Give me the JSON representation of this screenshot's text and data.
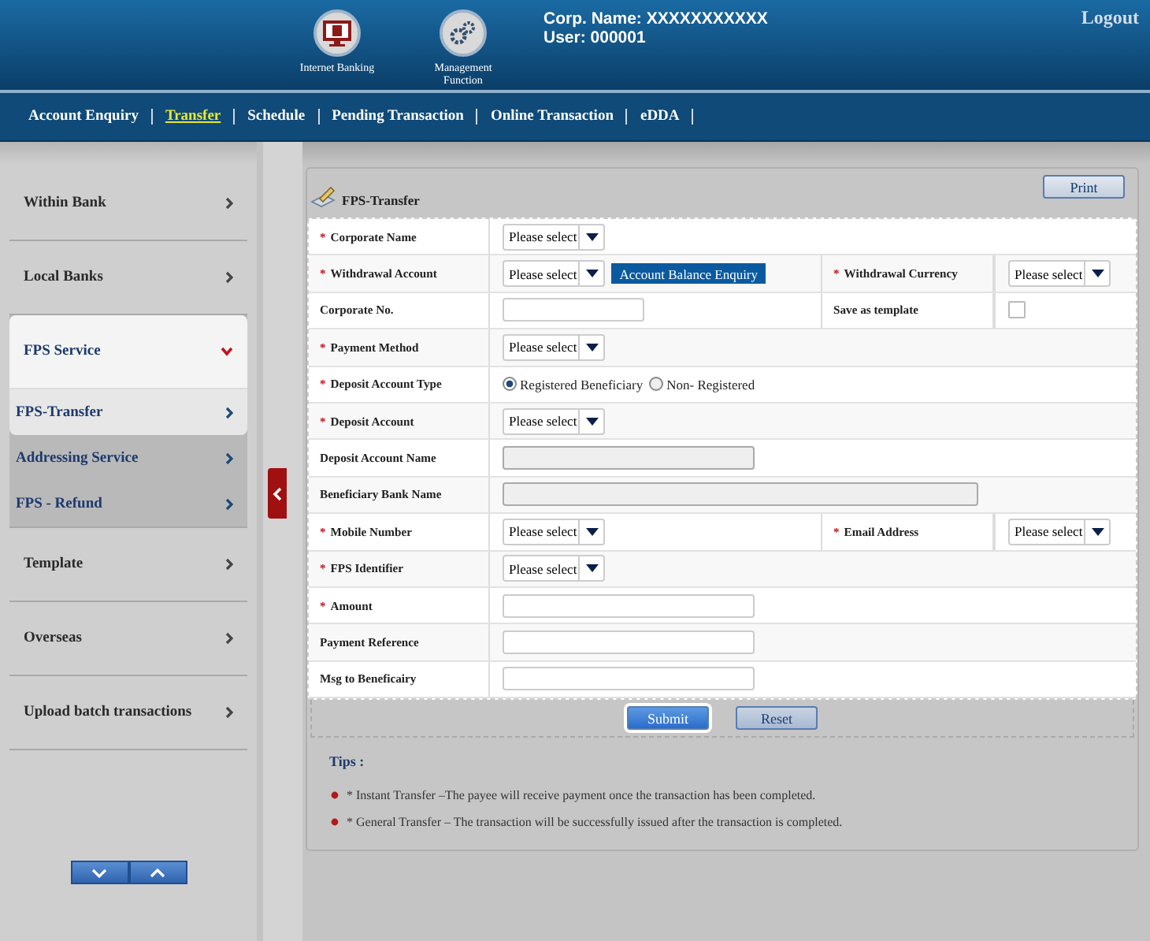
{
  "header": {
    "apps": [
      {
        "kind": "internet",
        "label": "Internet Banking"
      },
      {
        "kind": "management",
        "label": "Management Function"
      }
    ],
    "corp_name": "Corp. Name: XXXXXXXXXXX",
    "user": "User: 000001",
    "logout": "Logout"
  },
  "nav": [
    {
      "label": "Account Enquiry",
      "selected": false
    },
    {
      "label": "Transfer",
      "selected": true
    },
    {
      "label": "Schedule",
      "selected": false
    },
    {
      "label": "Pending Transaction",
      "selected": false
    },
    {
      "label": "Online Transaction",
      "selected": false
    },
    {
      "label": "eDDA",
      "selected": false
    }
  ],
  "sidebar": {
    "items": [
      {
        "label": "Within Bank",
        "expanded": false
      },
      {
        "label": "Local Banks",
        "expanded": false
      },
      {
        "label": "FPS Service",
        "expanded": true,
        "children": [
          {
            "label": "FPS-Transfer",
            "selected": true
          },
          {
            "label": "Addressing Service",
            "selected": false
          },
          {
            "label": "FPS - Refund",
            "selected": false
          }
        ]
      },
      {
        "label": "Template",
        "expanded": false
      },
      {
        "label": "Overseas",
        "expanded": false
      },
      {
        "label": "Upload batch transactions",
        "expanded": false
      }
    ]
  },
  "page": {
    "title": "FPS-Transfer",
    "print": "Print"
  },
  "form": {
    "rows": [
      {
        "fields": [
          {
            "mark": "*",
            "label": "Corporate Name",
            "control": {
              "kind": "select",
              "value": "Please select"
            }
          }
        ]
      },
      {
        "fields": [
          {
            "mark": "*",
            "label": "Withdrawal Account",
            "control": {
              "kind": "select",
              "value": "Please select",
              "button": "Account Balance Enquiry"
            }
          },
          {
            "mark": "*",
            "label": "Withdrawal Currency",
            "control": {
              "kind": "select",
              "value": "Please select"
            }
          }
        ]
      },
      {
        "fields": [
          {
            "label": "Corporate No.",
            "control": {
              "kind": "text"
            }
          },
          {
            "label": "Save as template",
            "control": {
              "kind": "checkbox",
              "checked": false
            }
          }
        ]
      },
      {
        "fields": [
          {
            "mark": "*",
            "label": "Payment Method",
            "control": {
              "kind": "select",
              "value": "Please select"
            }
          }
        ]
      },
      {
        "fields": [
          {
            "mark": "*",
            "label": "Deposit Account Type",
            "control": {
              "kind": "radio",
              "options": [
                {
                  "label": "Registered Beneficiary",
                  "selected": true
                },
                {
                  "label": "Non- Registered",
                  "selected": false
                }
              ]
            }
          }
        ]
      },
      {
        "fields": [
          {
            "mark": "*",
            "label": "Deposit Account",
            "control": {
              "kind": "select",
              "value": "Please select"
            }
          }
        ]
      },
      {
        "fields": [
          {
            "label": "Deposit Account Name",
            "control": {
              "kind": "readonly"
            }
          }
        ]
      },
      {
        "fields": [
          {
            "label": "Beneficiary Bank Name",
            "control": {
              "kind": "readonly_long"
            }
          }
        ]
      },
      {
        "fields": [
          {
            "mark": "*",
            "label": "Mobile Number",
            "control": {
              "kind": "select",
              "value": "Please select"
            }
          },
          {
            "mark": "*",
            "label": "Email Address",
            "control": {
              "kind": "select",
              "value": "Please select"
            }
          }
        ]
      },
      {
        "fields": [
          {
            "mark": "*",
            "label": "FPS Identifier",
            "control": {
              "kind": "select",
              "value": "Please select"
            }
          }
        ]
      },
      {
        "fields": [
          {
            "mark": "*",
            "label": "Amount",
            "control": {
              "kind": "text"
            }
          }
        ]
      },
      {
        "fields": [
          {
            "label": "Payment Reference",
            "control": {
              "kind": "text"
            }
          }
        ]
      },
      {
        "fields": [
          {
            "label": "Msg to Beneficairy",
            "control": {
              "kind": "text"
            }
          }
        ]
      }
    ],
    "buttons": [
      {
        "kind": "primary",
        "label": "Submit"
      },
      {
        "kind": "secondary",
        "label": "Reset"
      }
    ]
  },
  "tips": {
    "title": "Tips :",
    "items": [
      "* Instant Transfer –The payee will receive payment once the transaction has been completed.",
      "* General Transfer – The transaction will be successfully issued after the transaction is completed."
    ]
  }
}
